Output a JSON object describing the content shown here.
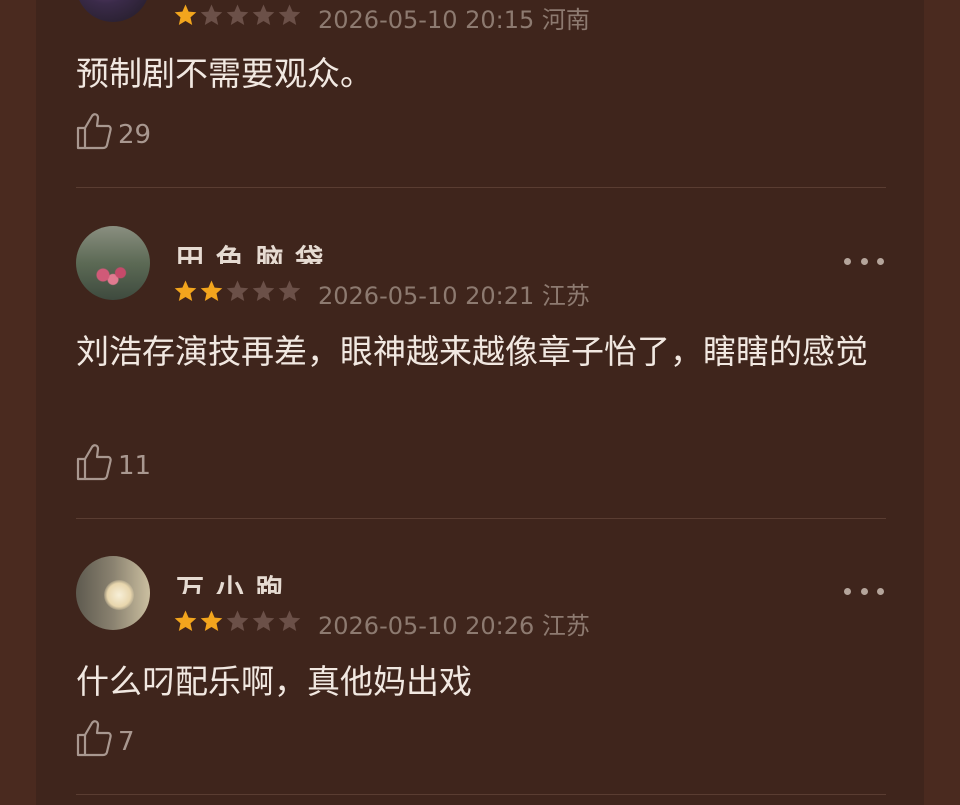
{
  "colors": {
    "background": "#3f251c",
    "outer": "#4a2a1f",
    "star_on": "#f2a51d",
    "star_off": "#6b5048",
    "text": "#f1e8e1",
    "meta": "#8d7a70"
  },
  "comments": [
    {
      "username": "",
      "rating": 1,
      "timestamp": "2026-05-10 20:15",
      "location": "河南",
      "text": "预制剧不需要观众。",
      "likes": "29"
    },
    {
      "username": "田 色 脑 袋",
      "rating": 2,
      "timestamp": "2026-05-10 20:21",
      "location": "江苏",
      "text": "刘浩存演技再差，眼神越来越像章子怡了，瞎瞎的感觉",
      "likes": "11"
    },
    {
      "username": "万 小 跑",
      "rating": 2,
      "timestamp": "2026-05-10 20:26",
      "location": "江苏",
      "text": "什么叼配乐啊，真他妈出戏",
      "likes": "7"
    }
  ],
  "icons": {
    "like": "thumb-up-icon",
    "more": "more-dots-icon"
  }
}
